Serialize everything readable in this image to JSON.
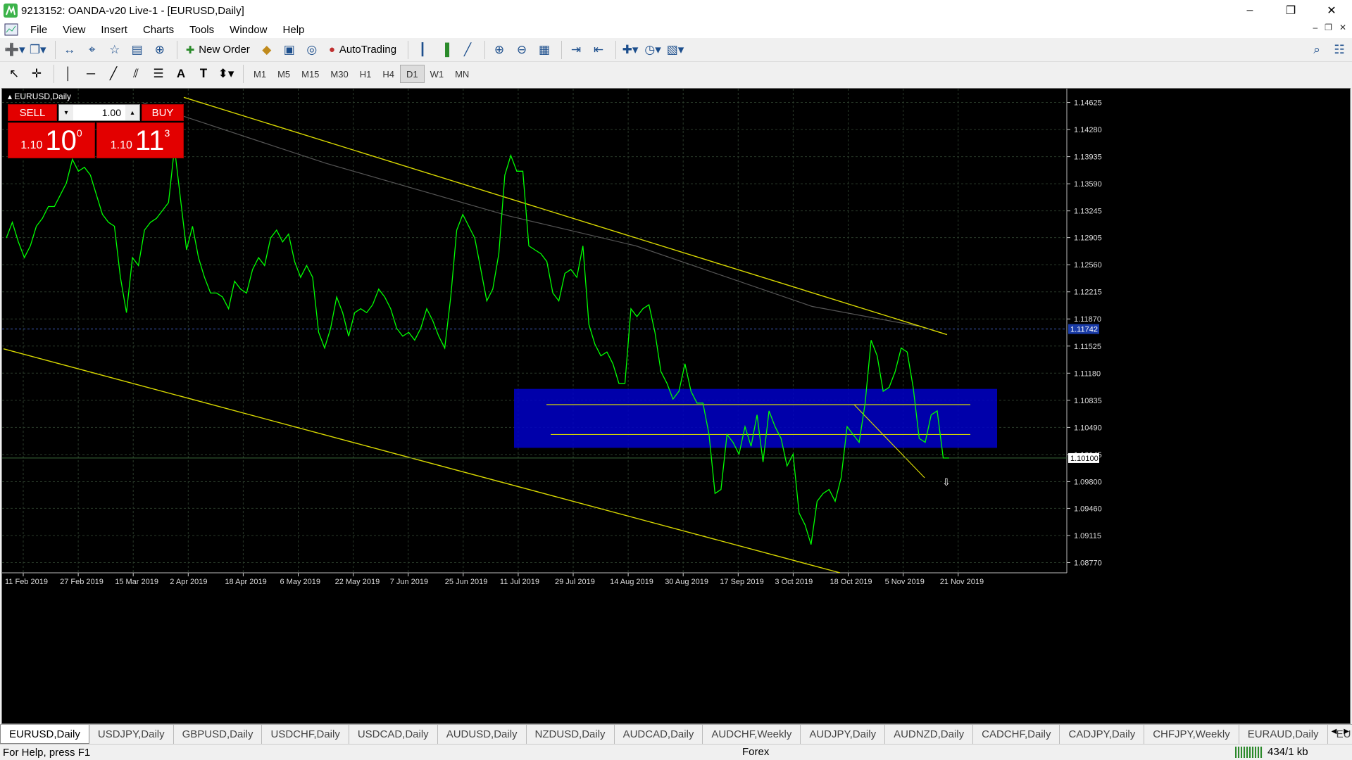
{
  "window": {
    "title": "9213152: OANDA-v20 Live-1 - [EURUSD,Daily]"
  },
  "menu": [
    "File",
    "View",
    "Insert",
    "Charts",
    "Tools",
    "Window",
    "Help"
  ],
  "toolbar": {
    "new_order": "New Order",
    "autotrading": "AutoTrading"
  },
  "timeframes": [
    "M1",
    "M5",
    "M15",
    "M30",
    "H1",
    "H4",
    "D1",
    "W1",
    "MN"
  ],
  "active_timeframe": "D1",
  "chart": {
    "label": "EURUSD,Daily",
    "trade_panel": {
      "sell_label": "SELL",
      "buy_label": "BUY",
      "lots": "1.00",
      "sell_small": "1.10",
      "sell_big": "10",
      "sell_sup": "0",
      "buy_small": "1.10",
      "buy_big": "11",
      "buy_sup": "3"
    }
  },
  "chart_data": {
    "type": "line",
    "symbol": "EURUSD",
    "timeframe": "Daily",
    "y_ticks": [
      "1.14625",
      "1.14280",
      "1.13935",
      "1.13590",
      "1.13245",
      "1.12905",
      "1.12560",
      "1.12215",
      "1.11870",
      "1.11525",
      "1.11180",
      "1.10835",
      "1.10490",
      "1.10145",
      "1.09800",
      "1.09460",
      "1.09115",
      "1.08770"
    ],
    "x_ticks": [
      "11 Feb 2019",
      "27 Feb 2019",
      "15 Mar 2019",
      "2 Apr 2019",
      "18 Apr 2019",
      "6 May 2019",
      "22 May 2019",
      "7 Jun 2019",
      "25 Jun 2019",
      "11 Jul 2019",
      "29 Jul 2019",
      "14 Aug 2019",
      "30 Aug 2019",
      "17 Sep 2019",
      "3 Oct 2019",
      "18 Oct 2019",
      "5 Nov 2019",
      "21 Nov 2019"
    ],
    "current_price": "1.10100",
    "marked_level": "1.11742",
    "ylim": [
      1.0864,
      1.148
    ],
    "grid": true,
    "colors": {
      "price_line": "#00ff00",
      "trendline": "#d8d800",
      "zone": "#0000c8",
      "background": "#000000",
      "ma": "#555555"
    },
    "series": [
      {
        "values": [
          1.129,
          1.131,
          1.1285,
          1.1265,
          1.128,
          1.1305,
          1.1315,
          1.133,
          1.133,
          1.1345,
          1.136,
          1.139,
          1.1375,
          1.138,
          1.137,
          1.1345,
          1.132,
          1.131,
          1.1305,
          1.124,
          1.1195,
          1.1265,
          1.1255,
          1.13,
          1.131,
          1.1315,
          1.1325,
          1.1335,
          1.1405,
          1.134,
          1.1275,
          1.1305,
          1.1265,
          1.124,
          1.122,
          1.122,
          1.1215,
          1.12,
          1.1235,
          1.1225,
          1.122,
          1.125,
          1.1265,
          1.1255,
          1.129,
          1.13,
          1.1285,
          1.1295,
          1.126,
          1.124,
          1.1255,
          1.124,
          1.117,
          1.115,
          1.1175,
          1.1215,
          1.1195,
          1.1165,
          1.1195,
          1.12,
          1.1195,
          1.1205,
          1.1225,
          1.1215,
          1.12,
          1.1175,
          1.1165,
          1.117,
          1.116,
          1.1175,
          1.12,
          1.1185,
          1.1165,
          1.115,
          1.1215,
          1.13,
          1.132,
          1.1305,
          1.129,
          1.125,
          1.121,
          1.1225,
          1.127,
          1.137,
          1.1395,
          1.1375,
          1.1375,
          1.128,
          1.1275,
          1.127,
          1.126,
          1.122,
          1.121,
          1.1245,
          1.125,
          1.124,
          1.128,
          1.118,
          1.1155,
          1.114,
          1.1145,
          1.113,
          1.1105,
          1.1105,
          1.12,
          1.119,
          1.12,
          1.1205,
          1.117,
          1.112,
          1.1105,
          1.1085,
          1.1095,
          1.113,
          1.1095,
          1.108,
          1.108,
          1.104,
          1.0965,
          1.097,
          1.104,
          1.103,
          1.1015,
          1.105,
          1.1025,
          1.1065,
          1.1005,
          1.107,
          1.105,
          1.1035,
          1.1,
          1.1015,
          1.094,
          1.0925,
          1.09,
          1.0955,
          1.0965,
          1.097,
          1.0955,
          1.0985,
          1.105,
          1.104,
          1.103,
          1.108,
          1.116,
          1.114,
          1.1095,
          1.11,
          1.112,
          1.115,
          1.1145,
          1.11,
          1.1035,
          1.103,
          1.1065,
          1.107,
          1.101,
          1.101
        ]
      }
    ]
  },
  "symbol_tabs": [
    "EURUSD,Daily",
    "USDJPY,Daily",
    "GBPUSD,Daily",
    "USDCHF,Daily",
    "USDCAD,Daily",
    "AUDUSD,Daily",
    "NZDUSD,Daily",
    "AUDCAD,Daily",
    "AUDCHF,Weekly",
    "AUDJPY,Daily",
    "AUDNZD,Daily",
    "CADCHF,Daily",
    "CADJPY,Daily",
    "CHFJPY,Weekly",
    "EURAUD,Daily",
    "EU"
  ],
  "status": {
    "help": "For Help, press F1",
    "group": "Forex",
    "traffic": "434/1 kb"
  }
}
